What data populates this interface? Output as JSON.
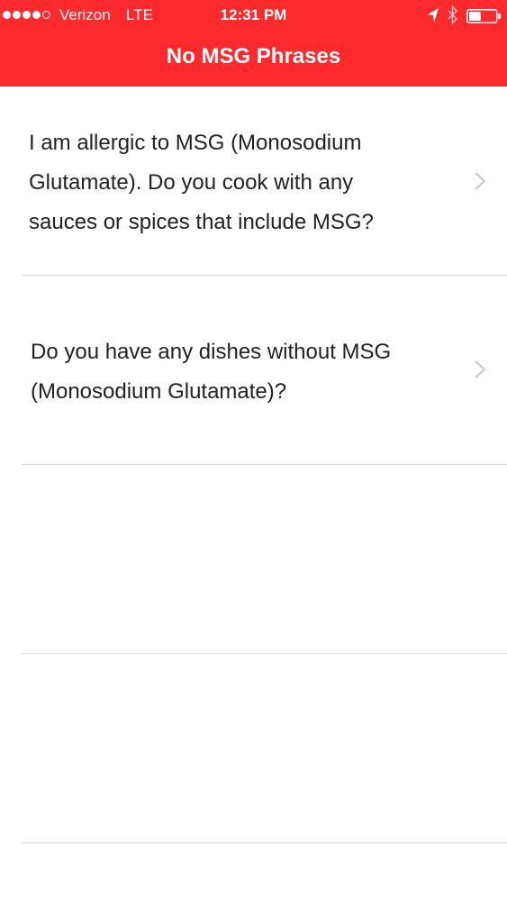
{
  "status_bar": {
    "carrier": "Verizon",
    "network": "LTE",
    "time": "12:31 PM",
    "signal_bars_filled": 4,
    "signal_bars_total": 5,
    "icons": [
      "location-arrow-icon",
      "bluetooth-icon",
      "battery-icon"
    ],
    "battery_level": 0.45
  },
  "header": {
    "title": "No MSG Phrases",
    "background_color": "#fd2a2d"
  },
  "phrases": [
    {
      "text": "I am allergic to MSG (Monosodium\nGlutamate). Do you cook with any\nsauces or spices that include MSG?",
      "icon": "chevron-right-icon"
    },
    {
      "text": "Do you have any dishes without MSG\n(Monosodium Glutamate)?",
      "icon": "chevron-right-icon"
    }
  ]
}
